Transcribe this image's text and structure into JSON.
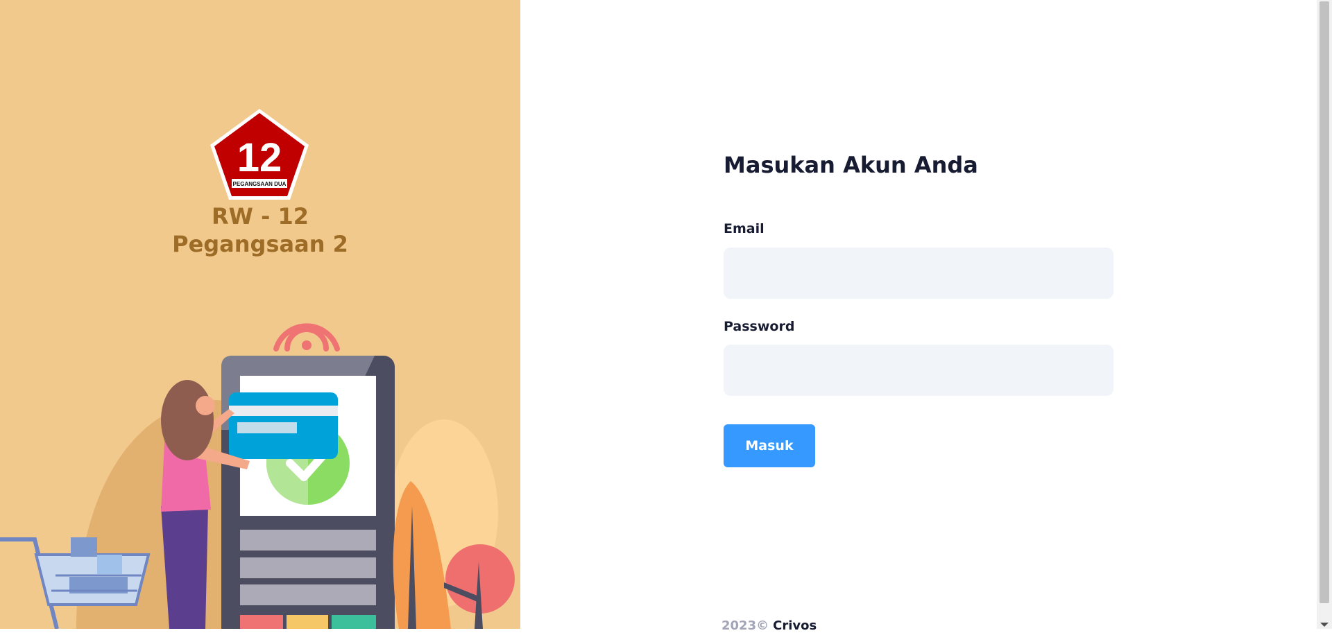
{
  "brand": {
    "logo_number": "12",
    "logo_caption": "PEGANGSAAN DUA",
    "title_line1": "RW - 12",
    "title_line2": "Pegangsaan 2"
  },
  "login": {
    "heading": "Masukan Akun Anda",
    "email_label": "Email",
    "email_value": "",
    "password_label": "Password",
    "password_value": "",
    "submit_label": "Masuk"
  },
  "footer": {
    "year": "2023©",
    "owner": "Crivos"
  },
  "colors": {
    "aside_bg": "#f2c98d",
    "brand_text": "#9d6c26",
    "logo_red": "#c00000",
    "primary_button": "#3699ff",
    "input_bg": "#f1f4f8",
    "heading_text": "#181c32"
  },
  "icons": {
    "logo": "pentagon-rw12-emblem",
    "illustration": "shopper-card-payment-terminal",
    "cart": "shopping-cart-icon",
    "wifi": "wifi-signal-icon",
    "check": "checkmark-icon"
  }
}
